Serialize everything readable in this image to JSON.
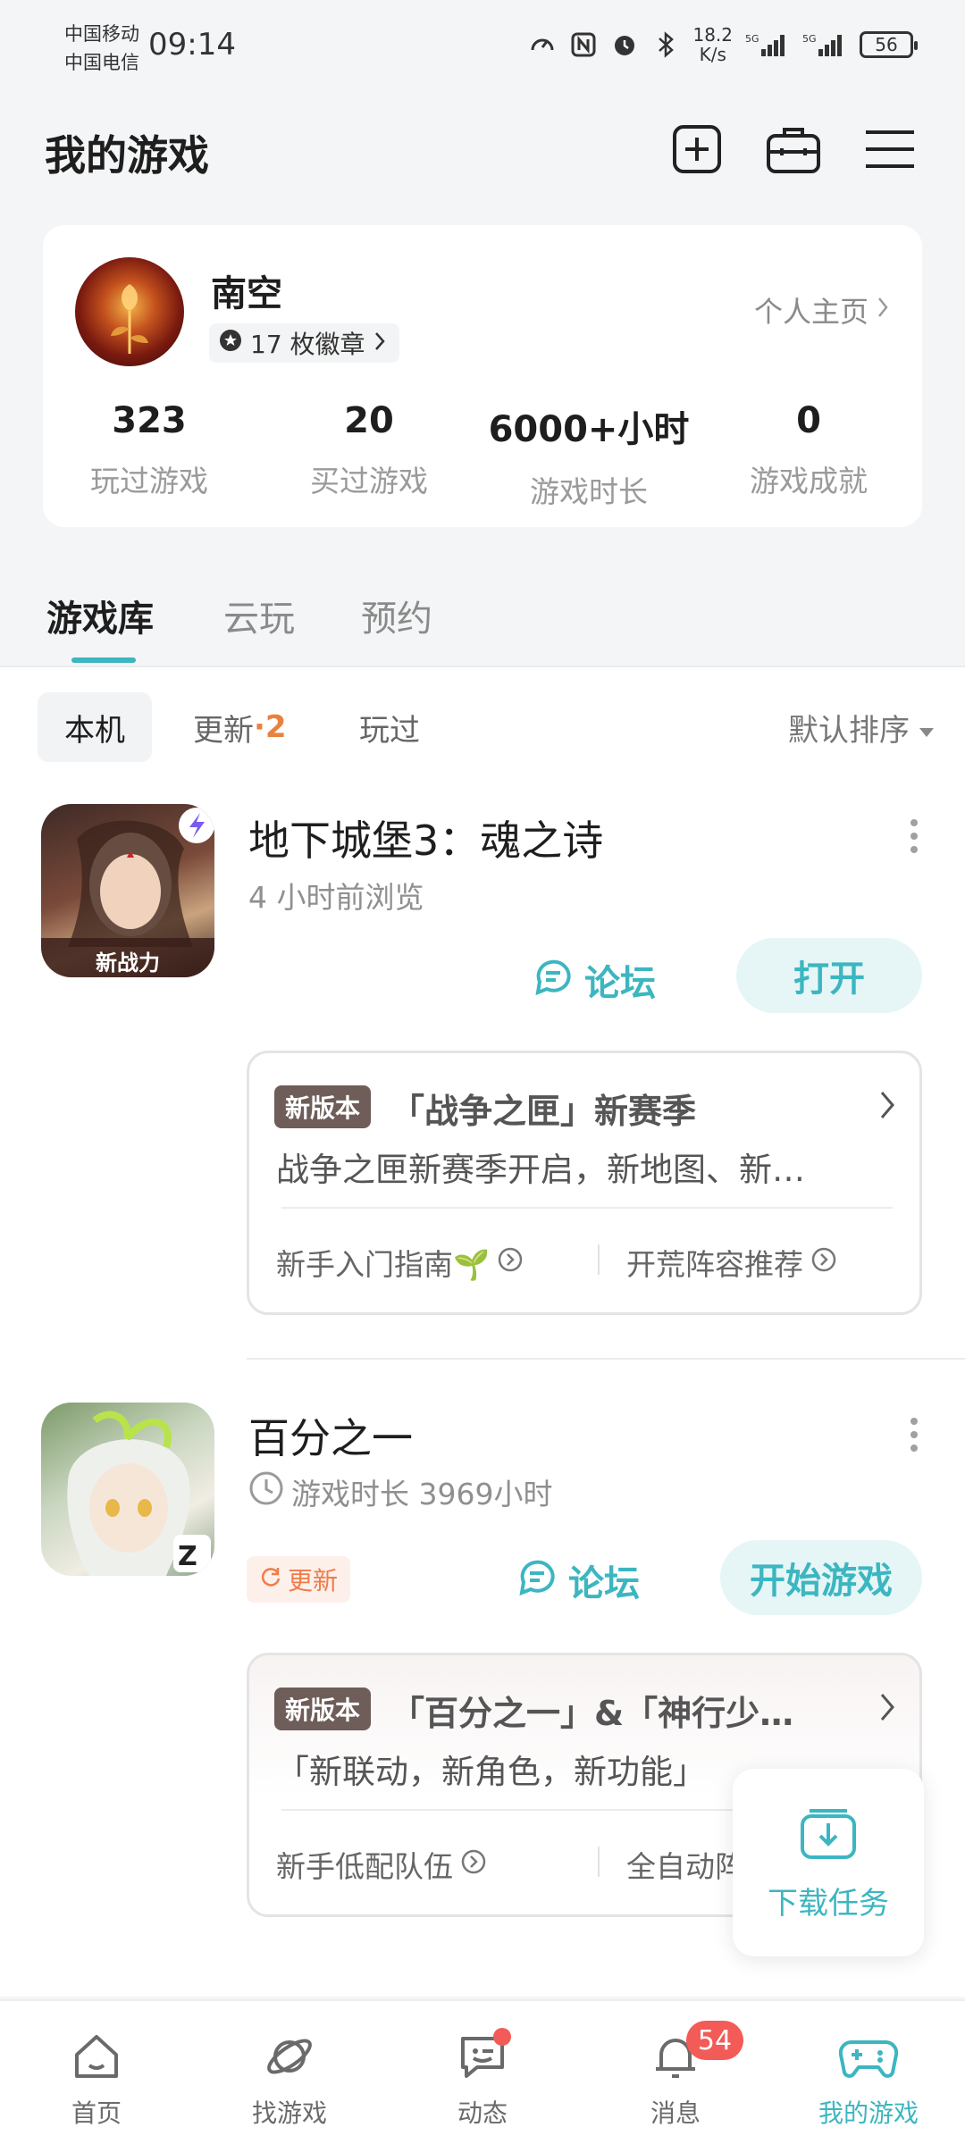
{
  "status_bar": {
    "carrier_1": "中国移动",
    "carrier_2": "中国电信",
    "time": "09:14",
    "net_speed_value": "18.2",
    "net_speed_unit": "K/s",
    "battery": "56",
    "icons": [
      "speed-icon",
      "nfc-icon",
      "alarm-icon",
      "bluetooth-icon",
      "signal-5g-icon",
      "signal-5g-icon"
    ]
  },
  "header": {
    "title": "我的游戏",
    "icons": [
      "add-icon",
      "toolbox-icon",
      "menu-icon"
    ]
  },
  "profile": {
    "name": "南空",
    "badges": "17 枚徽章",
    "homepage_link": "个人主页",
    "stats": [
      {
        "value": "323",
        "label": "玩过游戏"
      },
      {
        "value": "20",
        "label": "买过游戏"
      },
      {
        "value": "6000+小时",
        "label": "游戏时长"
      },
      {
        "value": "0",
        "label": "游戏成就"
      }
    ]
  },
  "tabs": [
    {
      "label": "游戏库",
      "active": true
    },
    {
      "label": "云玩",
      "active": false
    },
    {
      "label": "预约",
      "active": false
    }
  ],
  "filters": {
    "local": "本机",
    "update": "更新",
    "update_sep": "·",
    "update_count": "2",
    "played": "玩过",
    "sort": "默认排序"
  },
  "games": [
    {
      "name": "地下城堡3：魂之诗",
      "subtitle": "4 小时前浏览",
      "icon_caption": "新战力",
      "forum_label": "论坛",
      "primary_label": "打开",
      "news": {
        "tag": "新版本",
        "title": "「战争之匣」新赛季",
        "desc": "战争之匣新赛季开启，新地图、新…",
        "link_1": "新手入门指南🌱",
        "link_2": "开荒阵容推荐"
      }
    },
    {
      "name": "百分之一",
      "subtitle": "游戏时长 3969小时",
      "update_tag": "更新",
      "forum_label": "论坛",
      "primary_label": "开始游戏",
      "news": {
        "tag": "新版本",
        "title": "「百分之一」&「神行少…",
        "desc": "「新联动，新角色，新功能」",
        "link_1": "新手低配队伍",
        "link_2": "全自动阵"
      }
    }
  ],
  "download_float": {
    "label": "下载任务"
  },
  "bottom_nav": [
    {
      "label": "首页",
      "icon": "home-icon"
    },
    {
      "label": "找游戏",
      "icon": "planet-icon"
    },
    {
      "label": "动态",
      "icon": "chat-icon"
    },
    {
      "label": "消息",
      "icon": "bell-icon",
      "badge": "54"
    },
    {
      "label": "我的游戏",
      "icon": "gamepad-icon",
      "active": true
    }
  ],
  "colors": {
    "accent": "#3cb6c0",
    "badge_red": "#f25b57",
    "update_orange": "#e8823f"
  }
}
